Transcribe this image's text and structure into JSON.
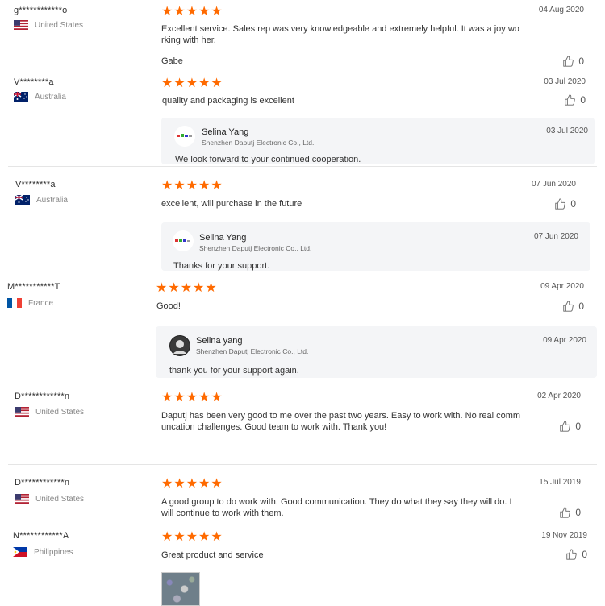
{
  "reviews": [
    {
      "user": "g************o",
      "country": "United States",
      "flag": "us",
      "date": "04 Aug 2020",
      "text": "Excellent service.  Sales rep was very knowledgeable and extremely helpful.  It was a joy wo\nrking with her.",
      "signature": "Gabe",
      "likes": "0"
    },
    {
      "user": "V********a",
      "country": "Australia",
      "flag": "au",
      "date": "03 Jul 2020",
      "text": "quality and packaging is excellent",
      "likes": "0",
      "reply": {
        "name": "Selina Yang",
        "company": "Shenzhen Daputj Electronic Co., Ltd.",
        "date": "03 Jul 2020",
        "text": "We look forward to your continued cooperation."
      }
    },
    {
      "user": "V********a",
      "country": "Australia",
      "flag": "au",
      "date": "07 Jun 2020",
      "text": "excellent, will purchase in the future",
      "likes": "0",
      "reply": {
        "name": "Selina Yang",
        "company": "Shenzhen Daputj Electronic Co., Ltd.",
        "date": "07 Jun 2020",
        "text": "Thanks for your support."
      }
    },
    {
      "user": "M***********T",
      "country": "France",
      "flag": "fr",
      "date": "09 Apr 2020",
      "text": "Good!",
      "likes": "0",
      "reply": {
        "name": "Selina yang",
        "company": "Shenzhen Daputj Electronic Co., Ltd.",
        "date": "09 Apr 2020",
        "text": "thank you for your support again."
      }
    },
    {
      "user": "D************n",
      "country": "United States",
      "flag": "us",
      "date": "02 Apr 2020",
      "text": "Daputj has been very good to me over the past two years.  Easy to work with.  No real comm\nuncation challenges.  Good team to work with.  Thank you!",
      "likes": "0"
    },
    {
      "user": "D************n",
      "country": "United States",
      "flag": "us",
      "date": "15 Jul 2019",
      "text": "A good group to do work with.  Good communication.  They do what they say they will do.  I\nwill continue to work with them.",
      "likes": "0"
    },
    {
      "user": "N************A",
      "country": "Philippines",
      "flag": "ph",
      "date": "19 Nov 2019",
      "text": "Great product and service",
      "likes": "0"
    }
  ],
  "stars": "★★★★★",
  "colors": {
    "star": "#ff6a00",
    "reply_bg": "#f4f5f7",
    "separator": "#e5e5e5"
  },
  "icons": {
    "like": "thumbs-up-icon"
  }
}
